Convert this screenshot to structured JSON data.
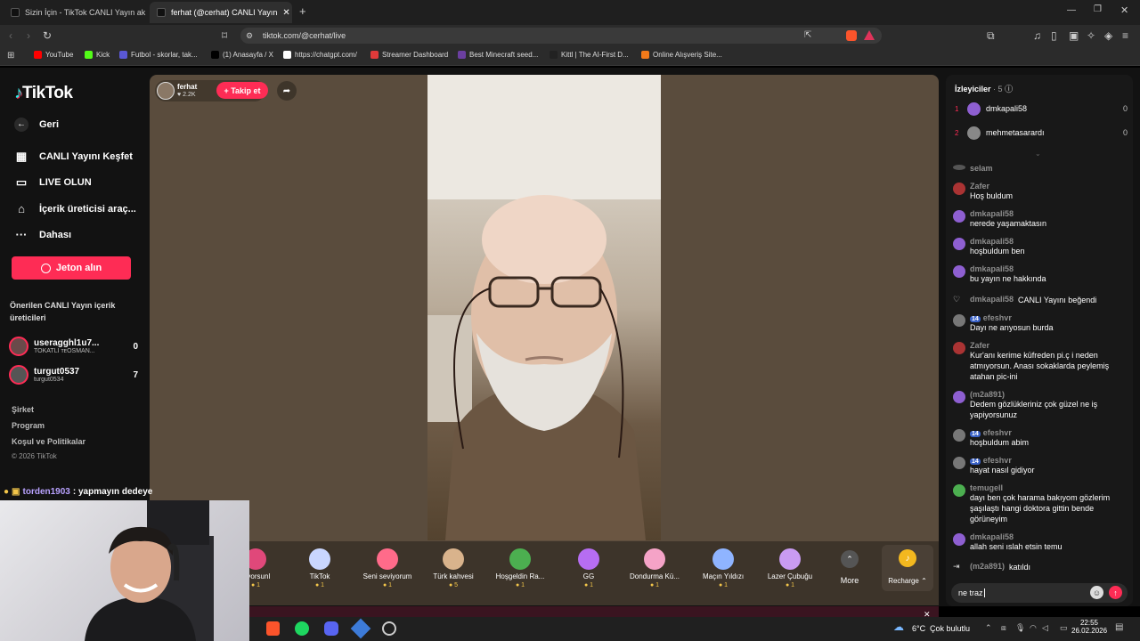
{
  "browser": {
    "tabs": [
      {
        "label": "Sizin İçin - TikTok CANLI Yayın akışı"
      },
      {
        "label": "ferhat (@cerhat) CANLI Yayın"
      }
    ],
    "new_tab": "+",
    "url": "tiktok.com/@cerhat/live",
    "bookmarks": [
      {
        "label": "YouTube",
        "color": "#ff0000"
      },
      {
        "label": "Kick",
        "color": "#53fc18"
      },
      {
        "label": "Futbol - skorlar, tak...",
        "color": "#5a58d6"
      },
      {
        "label": "(1) Anasayfa / X",
        "color": "#000000"
      },
      {
        "label": "https://chatgpt.com/",
        "color": "#ffffff"
      },
      {
        "label": "Streamer Dashboard",
        "color": "#e03a3a"
      },
      {
        "label": "Best Minecraft seed...",
        "color": "#6b3fa0"
      },
      {
        "label": "Kittl | The AI-First D...",
        "color": "#222222"
      },
      {
        "label": "Online Alışveriş Site...",
        "color": "#f27a1a"
      }
    ]
  },
  "sidebar": {
    "logo": "TikTok",
    "items": [
      {
        "label": "Geri",
        "icon": "back-arrow-icon",
        "glyph": "←"
      },
      {
        "label": "CANLI Yayını Keşfet",
        "icon": "live-explore-icon",
        "glyph": "▦"
      },
      {
        "label": "LIVE OLUN",
        "icon": "camera-icon",
        "glyph": "▭"
      },
      {
        "label": "İçerik üreticisi araç...",
        "icon": "creator-tools-icon",
        "glyph": "⌂"
      },
      {
        "label": "Dahası",
        "icon": "more-icon",
        "glyph": "···"
      }
    ],
    "jeton_button": "Jeton alın",
    "suggested_title": "Önerilen CANLI Yayın içerik üreticileri",
    "creators": [
      {
        "name": "useragghl1u7...",
        "sub": "TOKATLI тᴇOSMAN...",
        "count": "0"
      },
      {
        "name": "turgut0537",
        "sub": "turgut0534",
        "count": "7"
      }
    ],
    "footer": [
      "Şirket",
      "Program",
      "Koşul ve Politikalar",
      "© 2026 TikTok"
    ]
  },
  "stream": {
    "host_name": "ferhat",
    "host_likes": "2.2K",
    "follow_button": "+ Takip et",
    "gifts": [
      {
        "label": "...yorsunl",
        "price": "1",
        "color": "#e0487a"
      },
      {
        "label": "TikTok",
        "price": "1",
        "color": "#c9d6ff"
      },
      {
        "label": "Seni seviyorum",
        "price": "1",
        "color": "#ff6b8a"
      },
      {
        "label": "Türk kahvesi",
        "price": "5",
        "color": "#d9b38c"
      },
      {
        "label": "Hoşgeldin Ra...",
        "price": "1",
        "color": "#4caf50"
      },
      {
        "label": "GG",
        "price": "1",
        "color": "#b66df2"
      },
      {
        "label": "Dondurma Kü...",
        "price": "1",
        "color": "#f5a3c7"
      },
      {
        "label": "Maçın Yıldızı",
        "price": "1",
        "color": "#8fb4ff"
      },
      {
        "label": "Lazer Çubuğu",
        "price": "1",
        "color": "#c99bf2"
      }
    ],
    "more_label": "More",
    "recharge_label": "Recharge"
  },
  "viewers": {
    "title": "İzleyiciler",
    "count": "· 5",
    "list": [
      {
        "rank": "1",
        "name": "dmkapali58",
        "score": "0",
        "color": "#8e5fd1"
      },
      {
        "rank": "2",
        "name": "mehmetasarardı",
        "score": "0",
        "color": "#888888"
      }
    ]
  },
  "chat": {
    "messages": [
      {
        "name": "",
        "text": "selam",
        "color": "#555555",
        "top": 0
      },
      {
        "name": "Zafer",
        "text": "Hoş buldum",
        "color": "#a33"
      },
      {
        "name": "dmkapali58",
        "text": "nerede yaşamaktasın",
        "color": "#8e5fd1"
      },
      {
        "name": "dmkapali58",
        "text": "hoşbuldum ben",
        "color": "#8e5fd1"
      },
      {
        "name": "dmkapali58",
        "text": "bu yayın ne hakkında",
        "color": "#8e5fd1"
      }
    ],
    "liked": {
      "name": "dmkapali58",
      "text": "CANLI Yayını beğendi"
    },
    "messages2": [
      {
        "badge": "14",
        "name": "efeshvr",
        "text": "Dayı ne arıyosun burda",
        "color": "#777"
      },
      {
        "badge": "",
        "name": "Zafer",
        "text": "Kur'anı kerime küfreden pi.ç i neden atmıyorsun. Anası sokaklarda peylemiş atahan pic-ini",
        "color": "#a33"
      },
      {
        "badge": "",
        "name": "(m2a891)",
        "text": "Dedem gözlükleriniz çok güzel ne iş yapiyorsunuz",
        "color": "#8e5fd1"
      },
      {
        "badge": "14",
        "name": "efeshvr",
        "text": "hoşbuldum abim",
        "color": "#777"
      },
      {
        "badge": "14",
        "name": "efeshvr",
        "text": "hayat nasıl gidiyor",
        "color": "#777"
      },
      {
        "badge": "",
        "name": "temugell",
        "text": "dayı ben çok harama bakıyom gözlerim şaşılaştı hangi doktora gittin bende görüneyim",
        "color": "#4caf50"
      },
      {
        "badge": "",
        "name": "dmkapali58",
        "text": "allah seni ıslah etsin temu",
        "color": "#8e5fd1"
      }
    ],
    "joined": {
      "name": "(m2a891)",
      "text": "katıldı"
    },
    "input_value": "ne traz"
  },
  "overlay": {
    "cam_user": "torden1903",
    "cam_text": ": yapmayın dedeye"
  },
  "taskbar": {
    "weather_temp": "6°C",
    "weather_text": "Çok bulutlu",
    "time": "22:55",
    "date": "26.02.2026"
  }
}
